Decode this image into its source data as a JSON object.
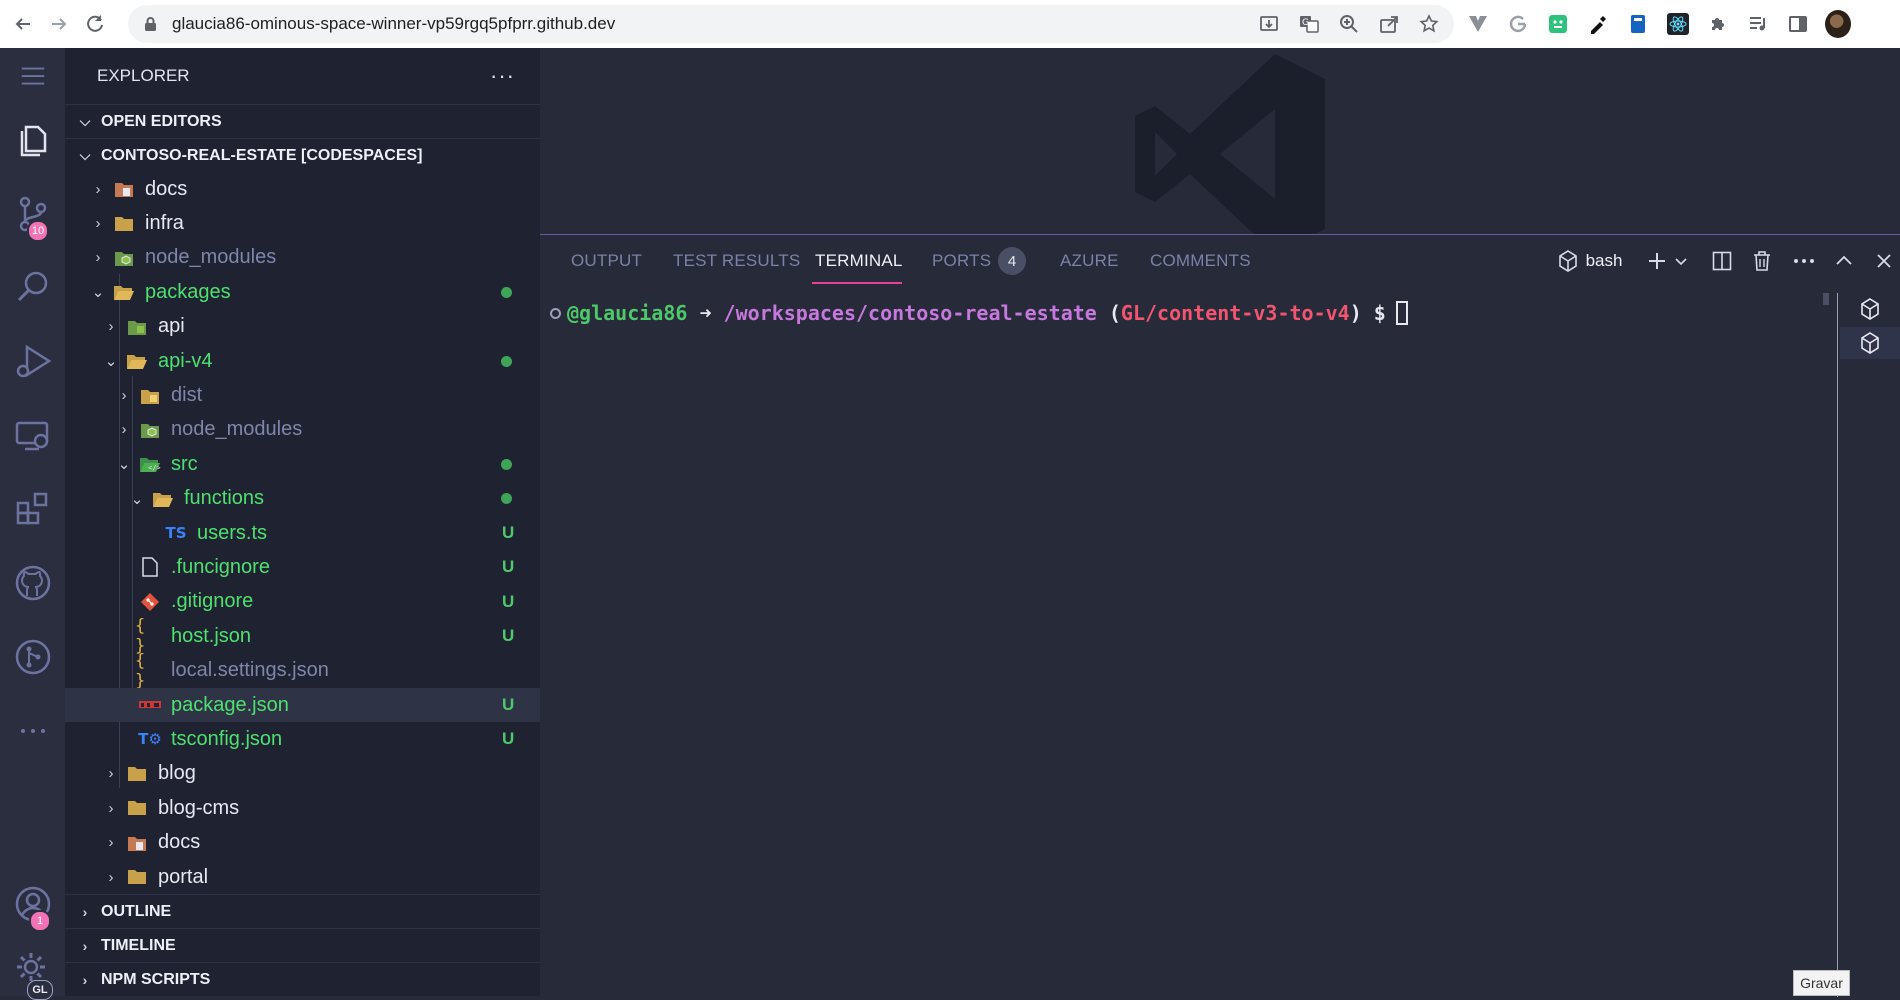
{
  "browser": {
    "url": "glaucia86-ominous-space-winner-vp59rgq5pfprr.github.dev",
    "back_icon": "arrow-left-icon",
    "forward_icon": "arrow-right-icon",
    "reload_icon": "reload-icon"
  },
  "activity_bar": {
    "scm_badge": "10",
    "accounts_badge": "1",
    "manage_badge": "GL"
  },
  "explorer": {
    "title": "EXPLORER",
    "more": "···",
    "open_editors": "OPEN EDITORS",
    "workspace": "CONTOSO-REAL-ESTATE [CODESPACES]",
    "tree": [
      {
        "label": "docs",
        "status": ""
      },
      {
        "label": "infra",
        "status": ""
      },
      {
        "label": "node_modules",
        "status": ""
      },
      {
        "label": "packages",
        "status": ""
      },
      {
        "label": "api",
        "status": ""
      },
      {
        "label": "api-v4",
        "status": ""
      },
      {
        "label": "dist",
        "status": ""
      },
      {
        "label": "node_modules",
        "status": ""
      },
      {
        "label": "src",
        "status": ""
      },
      {
        "label": "functions",
        "status": ""
      },
      {
        "label": "users.ts",
        "status": "U"
      },
      {
        "label": ".funcignore",
        "status": "U"
      },
      {
        "label": ".gitignore",
        "status": "U"
      },
      {
        "label": "host.json",
        "status": "U"
      },
      {
        "label": "local.settings.json",
        "status": ""
      },
      {
        "label": "package.json",
        "status": "U"
      },
      {
        "label": "tsconfig.json",
        "status": "U"
      },
      {
        "label": "blog",
        "status": ""
      },
      {
        "label": "blog-cms",
        "status": ""
      },
      {
        "label": "docs",
        "status": ""
      },
      {
        "label": "portal",
        "status": ""
      }
    ],
    "outline": "OUTLINE",
    "timeline": "TIMELINE",
    "npm_scripts": "NPM SCRIPTS"
  },
  "panel": {
    "tabs": [
      "OUTPUT",
      "TEST RESULTS",
      "TERMINAL",
      "PORTS",
      "AZURE",
      "COMMENTS"
    ],
    "active_tab": "TERMINAL",
    "ports_count": "4",
    "shell": "bash"
  },
  "terminal": {
    "user": "@glaucia86",
    "arrow": " ➜ ",
    "path": "/workspaces/contoso-real-estate",
    "branch_open": " (",
    "branch": "GL/content-v3-to-v4",
    "branch_close": ")",
    "prompt": " $"
  },
  "tooltip": "Gravar",
  "colors": {
    "accent": "#e5409a",
    "git_untracked": "#4ec96a",
    "badge": "#f472b6",
    "bg": "#262a39",
    "sidebar_bg": "#1f2231"
  }
}
